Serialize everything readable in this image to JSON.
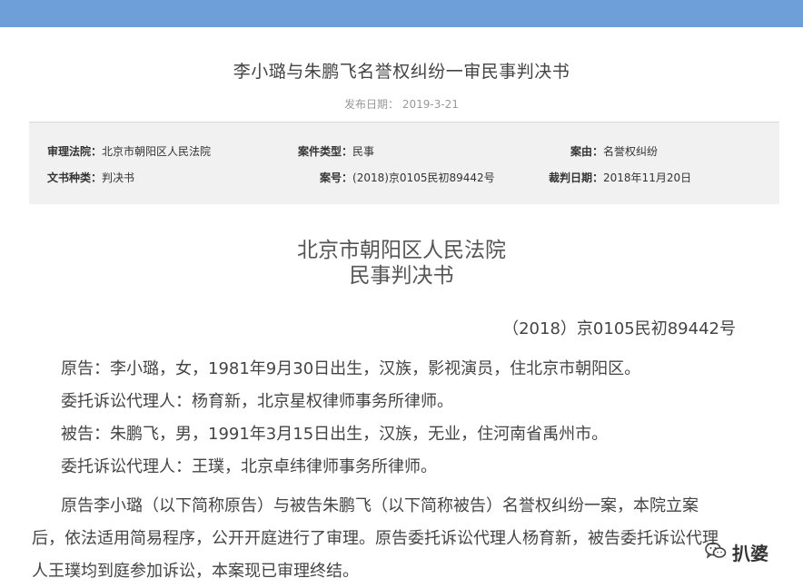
{
  "header": {
    "title": "李小璐与朱鹏飞名誉权纠纷一审民事判决书",
    "publish_date": "发布日期： 2019-3-21"
  },
  "meta": {
    "court_label": "审理法院：",
    "court_value": "北京市朝阳区人民法院",
    "case_type_label": "案件类型：",
    "case_type_value": "民事",
    "cause_label": "案由：",
    "cause_value": "名誉权纠纷",
    "doc_type_label": "文书种类：",
    "doc_type_value": "判决书",
    "case_no_label": "案号：",
    "case_no_value": "(2018)京0105民初89442号",
    "judgment_date_label": "裁判日期：",
    "judgment_date_value": "2018年11月20日"
  },
  "document": {
    "court_name": "北京市朝阳区人民法院",
    "doc_type": "民事判决书",
    "case_number": "（2018）京0105民初89442号",
    "plaintiff": "原告：李小璐，女，1981年9月30日出生，汉族，影视演员，住北京市朝阳区。",
    "plaintiff_agent": "委托诉讼代理人：杨育新，北京星权律师事务所律师。",
    "defendant": "被告：朱鹏飞，男，1991年3月15日出生，汉族，无业，住河南省禹州市。",
    "defendant_agent": "委托诉讼代理人：王璞，北京卓纬律师事务所律师。",
    "body_lines": [
      "原告李小璐（以下简称原告）与被告朱鹏飞（以下简称被告）名誉权纠纷一案，本院立案",
      "后，依法适用简易程序，公开开庭进行了审理。原告委托诉讼代理人杨育新，被告委托诉讼代理",
      "人王璞均到庭参加诉讼，本案现已审理终结。"
    ]
  },
  "watermark": {
    "text": "扒婆",
    "icon": "wechat-icon"
  },
  "colors": {
    "top_bar": "#6f9fd8",
    "meta_bg": "#f1f1f1"
  }
}
